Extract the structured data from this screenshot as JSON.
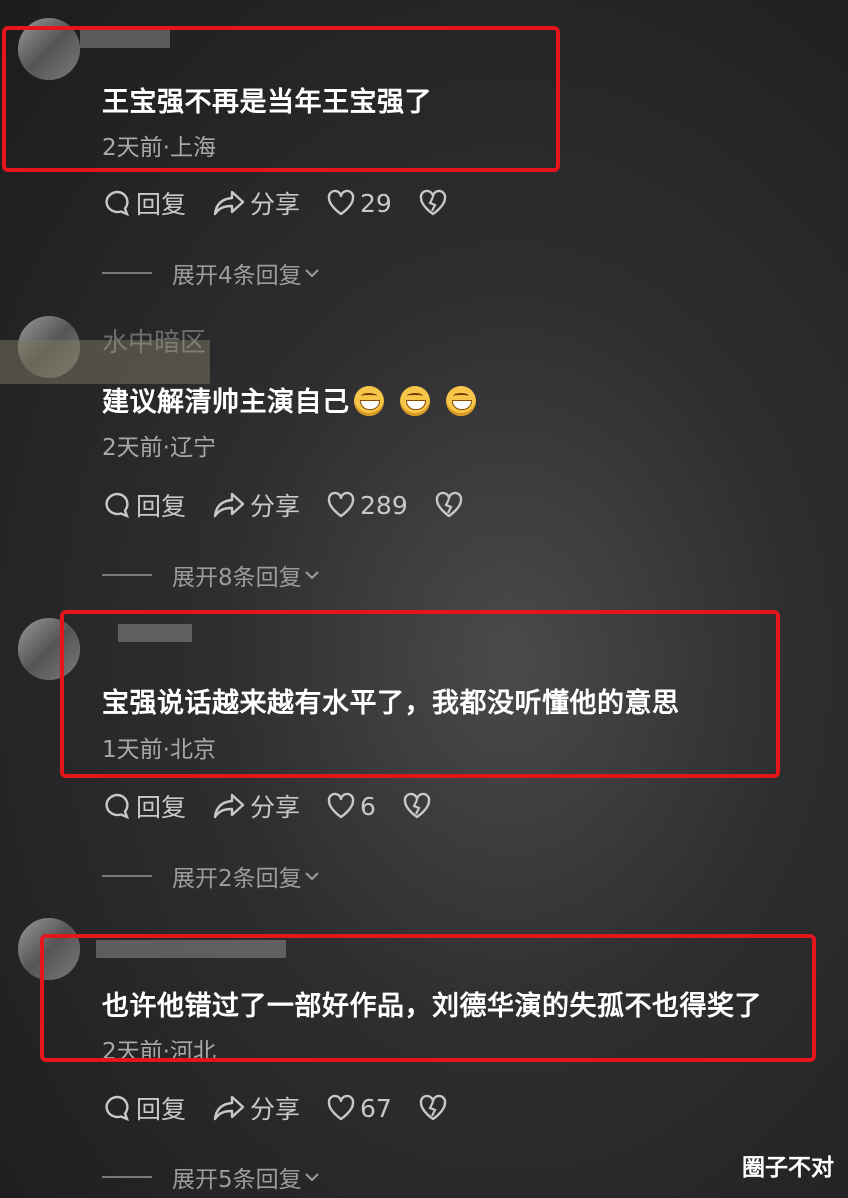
{
  "comments": [
    {
      "username": "",
      "text": "王宝强不再是当年王宝强了",
      "meta": "2天前·上海",
      "reply_label": "回复",
      "share_label": "分享",
      "likes": "29",
      "expand_label": "展开4条回复"
    },
    {
      "username": "水中暗区",
      "text": "建议解清帅主演自己",
      "emoji_count": 3,
      "meta": "2天前·辽宁",
      "reply_label": "回复",
      "share_label": "分享",
      "likes": "289",
      "expand_label": "展开8条回复"
    },
    {
      "username": "",
      "text": "宝强说话越来越有水平了，我都没听懂他的意思",
      "meta": "1天前·北京",
      "reply_label": "回复",
      "share_label": "分享",
      "likes": "6",
      "expand_label": "展开2条回复"
    },
    {
      "username": "",
      "text": "也许他错过了一部好作品，刘德华演的失孤不也得奖了",
      "meta": "2天前·河北",
      "reply_label": "回复",
      "share_label": "分享",
      "likes": "67",
      "expand_label": "展开5条回复"
    }
  ],
  "watermark": "圈子不对",
  "colors": {
    "highlight": "#e4151b",
    "text": "#ffffff",
    "meta": "#a8a8a8"
  }
}
